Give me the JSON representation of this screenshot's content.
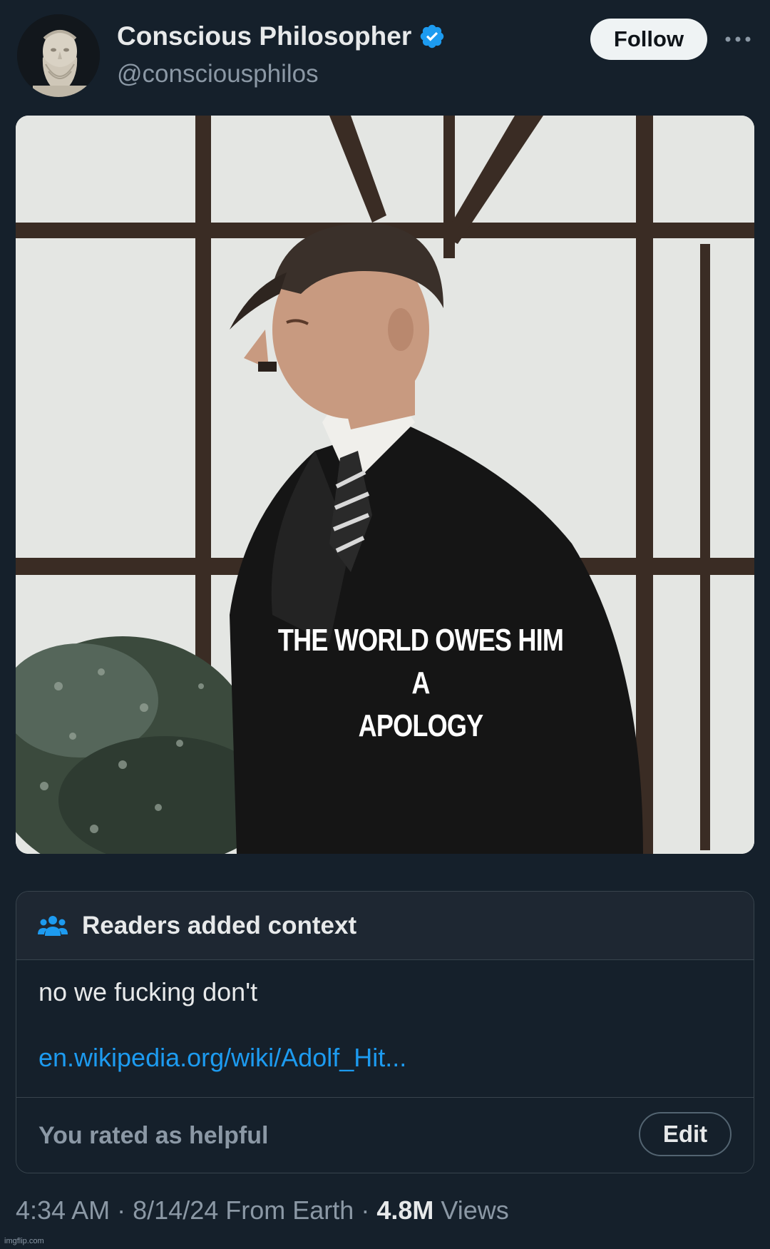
{
  "tweet": {
    "author": {
      "display_name": "Conscious Philosopher",
      "handle": "@consciousphilos",
      "avatar_icon": "philosopher-bust-avatar",
      "verified_icon": "verified-badge-icon",
      "verified_color": "#1d9bf0"
    },
    "follow_label": "Follow",
    "more_icon": "more-horizontal-icon",
    "media": {
      "caption_line1": "THE WORLD OWES HIM A",
      "caption_line2": "APOLOGY"
    },
    "community_note": {
      "icon": "people-icon",
      "title": "Readers added context",
      "text": "no we fucking don't",
      "link_text": "en.wikipedia.org/wiki/Adolf_Hit...",
      "rated_text": "You rated as helpful",
      "edit_label": "Edit",
      "link_color": "#1d9bf0"
    },
    "meta": {
      "time": "4:34 AM",
      "separator": "·",
      "date": "8/14/24",
      "location": "From Earth",
      "views_count": "4.8M",
      "views_label": "Views"
    },
    "watermark": "imgflip.com"
  },
  "colors": {
    "background": "#15202b",
    "text_primary": "#e7e9ea",
    "text_secondary": "#8b98a5",
    "border": "#38444d",
    "accent": "#1d9bf0"
  }
}
